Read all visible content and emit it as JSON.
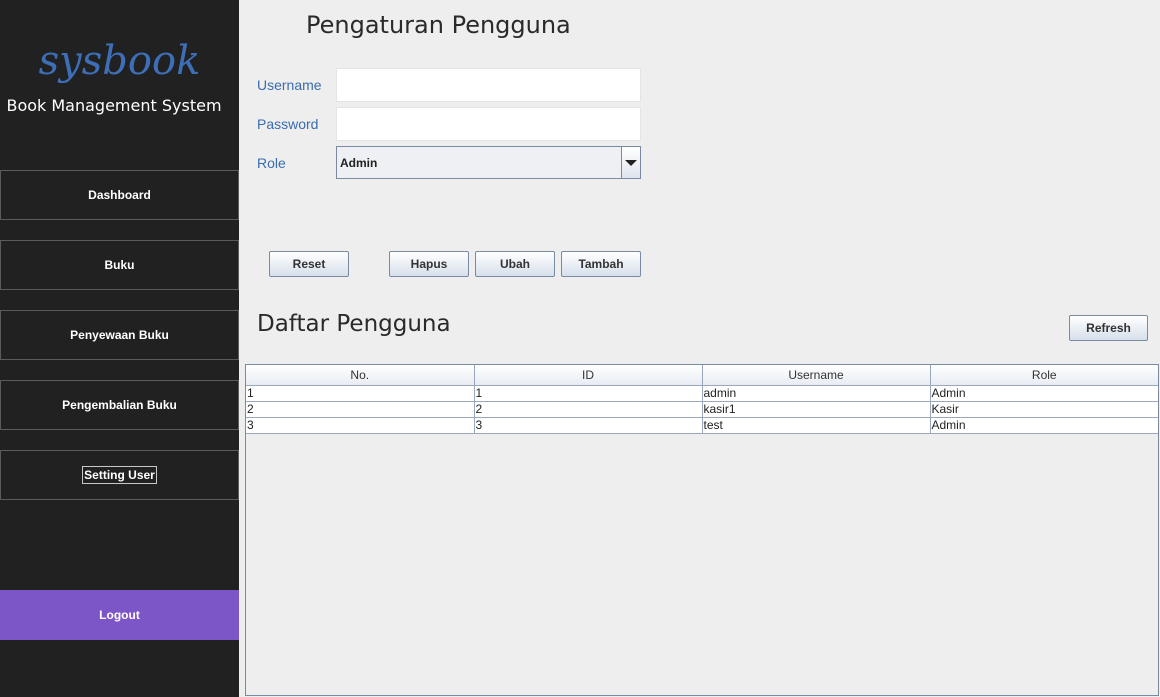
{
  "sidebar": {
    "logo": "sysbook",
    "tagline": "Book Management System",
    "nav": [
      "Dashboard",
      "Buku",
      "Penyewaan Buku",
      "Pengembalian Buku",
      "Setting User"
    ],
    "active": "Setting User",
    "logout": "Logout",
    "logout_color": "#7c56c6"
  },
  "form": {
    "title": "Pengaturan Pengguna",
    "username_label": "Username",
    "username_value": "",
    "password_label": "Password",
    "password_value": "",
    "role_label": "Role",
    "role_value": "Admin"
  },
  "buttons": {
    "reset": "Reset",
    "hapus": "Hapus",
    "ubah": "Ubah",
    "tambah": "Tambah"
  },
  "list": {
    "title": "Daftar Pengguna",
    "refresh": "Refresh",
    "columns": [
      "No.",
      "ID",
      "Username",
      "Role"
    ],
    "rows": [
      [
        "1",
        "1",
        "admin",
        "Admin"
      ],
      [
        "2",
        "2",
        "kasir1",
        "Kasir"
      ],
      [
        "3",
        "3",
        "test",
        "Admin"
      ]
    ]
  }
}
